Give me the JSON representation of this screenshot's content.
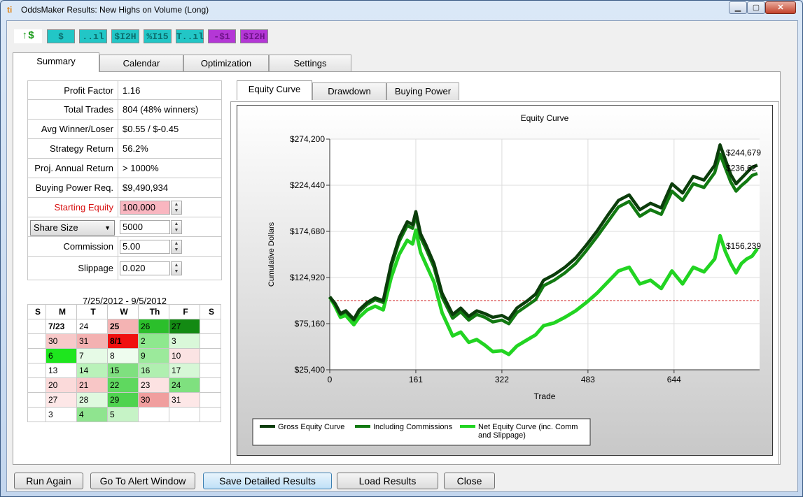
{
  "window": {
    "title": "OddsMaker Results: New Highs on Volume (Long)",
    "app_icon": "ti",
    "min_label": "▁",
    "max_label": "▢",
    "close_label": "✕"
  },
  "toolbar": [
    "↑$",
    "$",
    "..ıl",
    "$I2H",
    "%I15",
    "T..ıl",
    "-$1",
    "$I2H"
  ],
  "tabs": [
    "Summary",
    "Calendar",
    "Optimization",
    "Settings"
  ],
  "stats": [
    {
      "label": "Profit Factor",
      "value": "1.16"
    },
    {
      "label": "Total Trades",
      "value": "804 (48% winners)"
    },
    {
      "label": "Avg Winner/Loser",
      "value": "$0.55 / $-0.45"
    },
    {
      "label": "Strategy Return",
      "value": "56.2%"
    },
    {
      "label": "Proj. Annual Return",
      "value": "> 1000%"
    },
    {
      "label": "Buying Power Req.",
      "value": "$9,490,934"
    }
  ],
  "inputs": {
    "starting_equity_label": "Starting Equity",
    "starting_equity": "100,000",
    "share_size_option": "Share Size",
    "share_size": "5000",
    "commission_label": "Commission",
    "commission": "5.00",
    "slippage_label": "Slippage",
    "slippage": "0.020"
  },
  "calendar": {
    "range": "7/25/2012 - 9/5/2012",
    "headers": [
      "S",
      "M",
      "T",
      "W",
      "Th",
      "F",
      "S"
    ],
    "rows": [
      [
        {
          "t": ""
        },
        {
          "t": "7/23",
          "b": 1
        },
        {
          "t": "24"
        },
        {
          "t": "25",
          "b": 1,
          "c": "#f4b3b3"
        },
        {
          "t": "26",
          "c": "#2bbf2b"
        },
        {
          "t": "27",
          "c": "#138a13"
        },
        {
          "t": ""
        }
      ],
      [
        {
          "t": ""
        },
        {
          "t": "30",
          "c": "#f7c9c9"
        },
        {
          "t": "31",
          "c": "#f3b1b1"
        },
        {
          "t": "8/1",
          "b": 1,
          "c": "#f01010"
        },
        {
          "t": "2",
          "c": "#8ee88e"
        },
        {
          "t": "3",
          "c": "#d9f8d9"
        },
        {
          "t": ""
        }
      ],
      [
        {
          "t": ""
        },
        {
          "t": "6",
          "c": "#1ee61e"
        },
        {
          "t": "7",
          "c": "#e6fae6"
        },
        {
          "t": "8",
          "c": "#eefcee"
        },
        {
          "t": "9",
          "c": "#9bea9b"
        },
        {
          "t": "10",
          "c": "#fbe3e3"
        },
        {
          "t": ""
        }
      ],
      [
        {
          "t": ""
        },
        {
          "t": "13",
          "c": "#ffffff"
        },
        {
          "t": "14",
          "c": "#b9f2b9"
        },
        {
          "t": "15",
          "c": "#7fe07f"
        },
        {
          "t": "16",
          "c": "#b0efb0"
        },
        {
          "t": "17",
          "c": "#d6f7d6"
        },
        {
          "t": ""
        }
      ],
      [
        {
          "t": ""
        },
        {
          "t": "20",
          "c": "#fbdada"
        },
        {
          "t": "21",
          "c": "#f8c6c6"
        },
        {
          "t": "22",
          "c": "#5fd85f"
        },
        {
          "t": "23",
          "c": "#fce2e2"
        },
        {
          "t": "24",
          "c": "#7fe07f"
        },
        {
          "t": ""
        }
      ],
      [
        {
          "t": ""
        },
        {
          "t": "27",
          "c": "#fde7e7"
        },
        {
          "t": "28",
          "c": "#dff9df"
        },
        {
          "t": "29",
          "c": "#4fd34f"
        },
        {
          "t": "30",
          "c": "#f09e9e"
        },
        {
          "t": "31",
          "c": "#fde7e7"
        },
        {
          "t": ""
        }
      ],
      [
        {
          "t": ""
        },
        {
          "t": "3",
          "c": "#ffffff"
        },
        {
          "t": "4",
          "c": "#8fe48f"
        },
        {
          "t": "5",
          "c": "#c6f3c6"
        },
        {
          "t": ""
        },
        {
          "t": ""
        },
        {
          "t": ""
        }
      ]
    ]
  },
  "chart_tabs": [
    "Equity Curve",
    "Drawdown",
    "Buying Power"
  ],
  "chart_data": {
    "type": "line",
    "title": "Equity Curve",
    "xlabel": "Trade",
    "ylabel": "Cumulative Dollars",
    "xlim": [
      0,
      804
    ],
    "ylim": [
      25400,
      274200
    ],
    "x_ticks": [
      "0",
      "161",
      "322",
      "483",
      "644"
    ],
    "y_ticks": [
      "$274,200",
      "$224,440",
      "$174,680",
      "$124,920",
      "$75,160",
      "$25,400"
    ],
    "baseline": 100000,
    "series": [
      {
        "name": "Gross Equity Curve",
        "color": "#0b3d0b",
        "x": [
          0,
          10,
          20,
          30,
          45,
          55,
          70,
          85,
          100,
          115,
          130,
          145,
          155,
          161,
          170,
          180,
          195,
          210,
          230,
          245,
          260,
          275,
          290,
          305,
          322,
          335,
          350,
          370,
          385,
          400,
          420,
          440,
          460,
          480,
          500,
          520,
          540,
          560,
          580,
          600,
          620,
          640,
          660,
          680,
          700,
          720,
          730,
          740,
          750,
          760,
          770,
          780,
          790,
          800
        ],
        "y": [
          104000,
          97000,
          86000,
          89000,
          80000,
          90000,
          98000,
          103000,
          100000,
          140000,
          168000,
          185000,
          182000,
          196000,
          172000,
          160000,
          140000,
          108000,
          85000,
          92000,
          83000,
          89000,
          86000,
          82000,
          84000,
          80000,
          92000,
          100000,
          107000,
          122000,
          128000,
          136000,
          146000,
          160000,
          175000,
          192000,
          208000,
          214000,
          198000,
          205000,
          200000,
          226000,
          216000,
          234000,
          230000,
          246000,
          268000,
          252000,
          236000,
          226000,
          232000,
          238000,
          244000,
          246000
        ]
      },
      {
        "name": "Including Commissions",
        "color": "#127a12",
        "x": [
          0,
          10,
          20,
          30,
          45,
          55,
          70,
          85,
          100,
          115,
          130,
          145,
          155,
          161,
          170,
          180,
          195,
          210,
          230,
          245,
          260,
          275,
          290,
          305,
          322,
          335,
          350,
          370,
          385,
          400,
          420,
          440,
          460,
          480,
          500,
          520,
          540,
          560,
          580,
          600,
          620,
          640,
          660,
          680,
          700,
          720,
          730,
          740,
          750,
          760,
          770,
          780,
          790,
          800
        ],
        "y": [
          104000,
          96000,
          85000,
          88000,
          79000,
          88000,
          96000,
          101000,
          98000,
          137000,
          164000,
          181000,
          178000,
          192000,
          168000,
          156000,
          136000,
          104000,
          81000,
          88000,
          79000,
          85000,
          82000,
          77000,
          79000,
          75000,
          87000,
          95000,
          101000,
          116000,
          122000,
          130000,
          140000,
          154000,
          169000,
          185000,
          201000,
          207000,
          191000,
          198000,
          193000,
          218000,
          208000,
          226000,
          222000,
          238000,
          258000,
          243000,
          228000,
          218000,
          224000,
          229000,
          235000,
          237000
        ]
      },
      {
        "name": "Net Equity Curve (inc. Comm and Slippage)",
        "color": "#22d422",
        "x": [
          0,
          10,
          20,
          30,
          45,
          55,
          70,
          85,
          100,
          115,
          130,
          145,
          155,
          161,
          170,
          180,
          195,
          210,
          230,
          245,
          260,
          275,
          290,
          305,
          322,
          335,
          350,
          370,
          385,
          400,
          420,
          440,
          460,
          480,
          500,
          520,
          540,
          560,
          580,
          600,
          620,
          640,
          660,
          680,
          700,
          720,
          730,
          740,
          750,
          760,
          770,
          780,
          790,
          800
        ],
        "y": [
          104000,
          94000,
          82000,
          84000,
          74000,
          82000,
          90000,
          94000,
          90000,
          125000,
          150000,
          165000,
          161000,
          176000,
          152000,
          139000,
          120000,
          87000,
          62000,
          66000,
          55000,
          58000,
          52000,
          45000,
          46000,
          42000,
          51000,
          58000,
          63000,
          73000,
          76000,
          82000,
          89000,
          98000,
          108000,
          120000,
          132000,
          136000,
          118000,
          122000,
          113000,
          132000,
          118000,
          136000,
          131000,
          145000,
          170000,
          153000,
          140000,
          130000,
          140000,
          145000,
          148000,
          156000
        ]
      }
    ],
    "end_labels": [
      "$244,679",
      "$236,62",
      "$156,239"
    ],
    "legend": [
      "Gross Equity Curve",
      "Including Commissions",
      "Net Equity Curve (inc. Comm\nand Slippage)"
    ],
    "legend_position": "bottom-left"
  },
  "buttons": [
    "Run Again",
    "Go To Alert Window",
    "Save Detailed Results",
    "Load Results",
    "Close"
  ]
}
